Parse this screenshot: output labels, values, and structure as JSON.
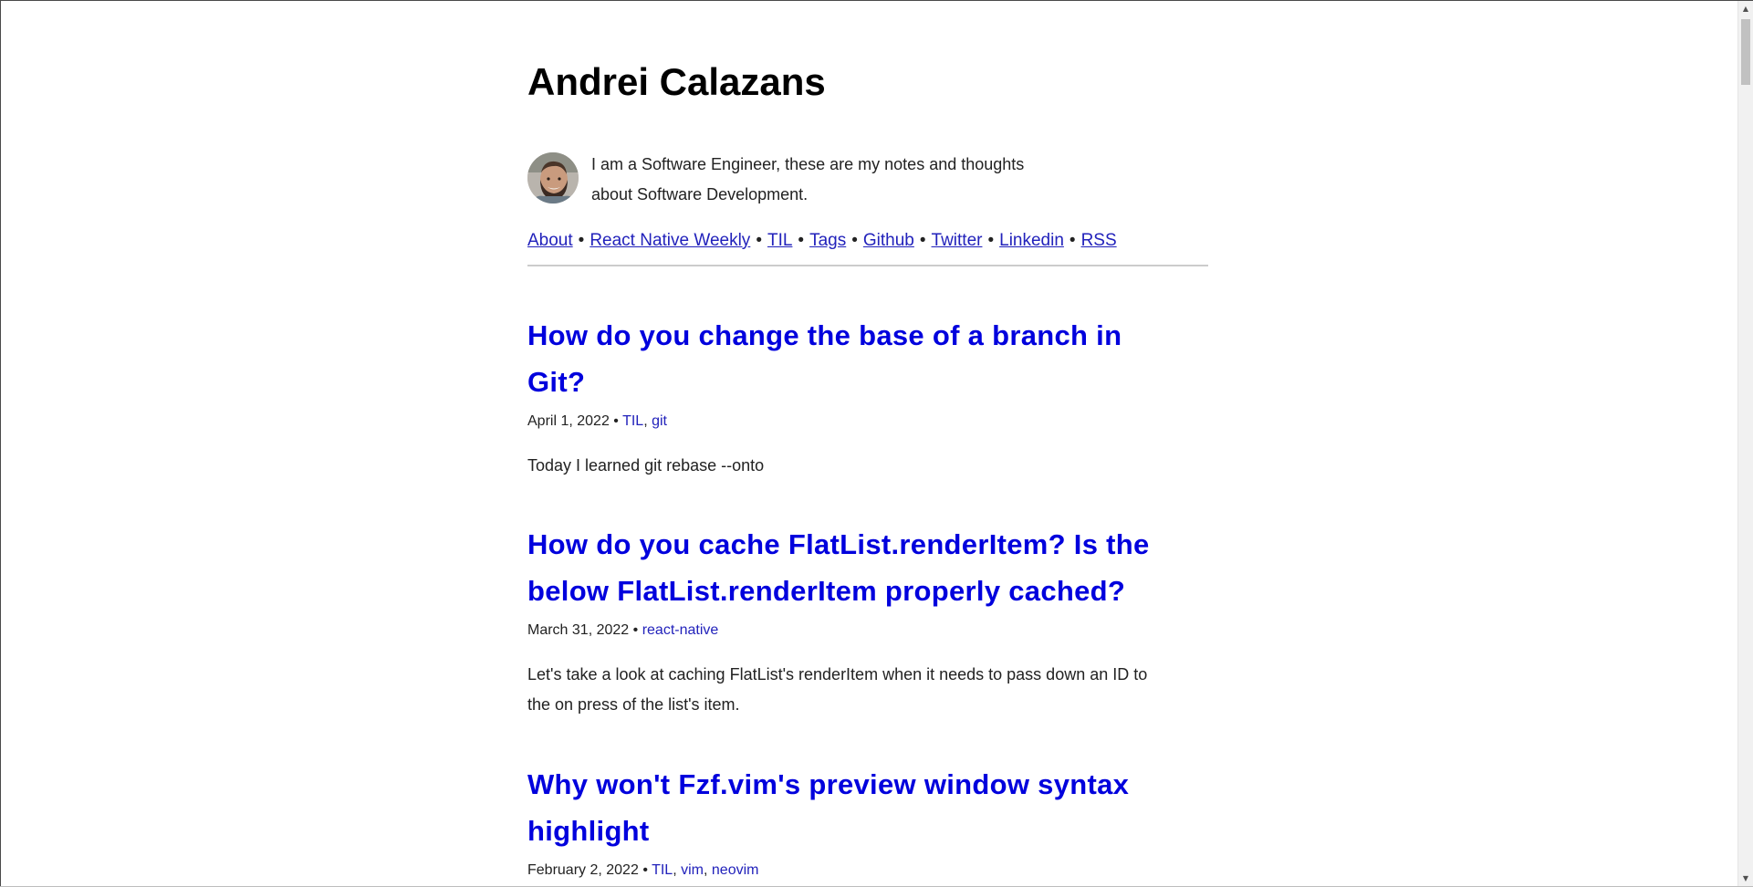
{
  "site": {
    "title": "Andrei Calazans",
    "intro_line1": "I am a Software Engineer, these are my notes and thoughts",
    "intro_line2": "about Software Development."
  },
  "nav": {
    "items": [
      {
        "label": "About"
      },
      {
        "label": "React Native Weekly"
      },
      {
        "label": "TIL"
      },
      {
        "label": "Tags"
      },
      {
        "label": "Github"
      },
      {
        "label": "Twitter"
      },
      {
        "label": "Linkedin"
      },
      {
        "label": "RSS"
      }
    ],
    "separator": "•"
  },
  "posts": [
    {
      "title_line1": "How do you change the base of a branch in",
      "title_line2": "Git?",
      "date": "April 1, 2022",
      "meta_sep": "•",
      "tags": [
        "TIL",
        "git"
      ],
      "excerpt": "Today I learned git rebase --onto"
    },
    {
      "title_line1": "How do you cache FlatList.renderItem? Is the",
      "title_line2": "below FlatList.renderItem properly cached?",
      "date": "March 31, 2022",
      "meta_sep": "•",
      "tags": [
        "react-native"
      ],
      "excerpt_line1": "Let's take a look at caching FlatList's renderItem when it needs to pass down an ID to",
      "excerpt_line2": "the on press of the list's item."
    },
    {
      "title_line1": "Why won't Fzf.vim's preview window syntax",
      "title_line2": "highlight",
      "date": "February 2, 2022",
      "meta_sep": "•",
      "tags": [
        "TIL",
        "vim",
        "neovim"
      ]
    }
  ],
  "tag_separator": ",",
  "colors": {
    "link": "#2222bb",
    "post_title": "#0000dd",
    "text": "#222222",
    "rule": "#cccccc"
  },
  "icons": {
    "avatar": "author-avatar",
    "scroll_up": "scroll-up-arrow-icon",
    "scroll_down": "scroll-down-arrow-icon"
  }
}
